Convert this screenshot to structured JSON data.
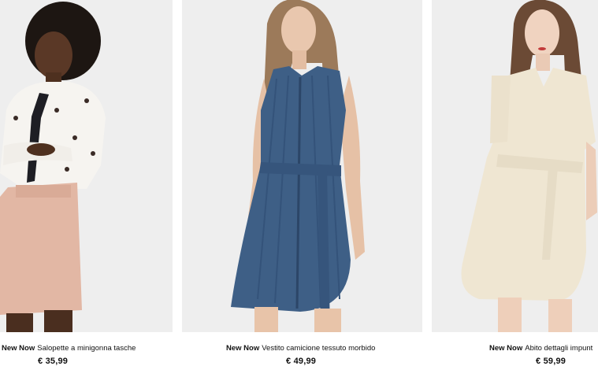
{
  "products": [
    {
      "tag": "New Now",
      "name": "Salopette a minigonna tasche",
      "price": "€ 35,99"
    },
    {
      "tag": "New Now",
      "name": "Vestito camicione tessuto morbido",
      "price": "€ 49,99"
    },
    {
      "tag": "New Now",
      "name": "Abito dettagli impunt",
      "price": "€ 59,99"
    }
  ],
  "colors": {
    "photo_background": "#eeeeee",
    "skirt": "#e2b7a4",
    "denim_dress": "#3e5f86",
    "cream_dress": "#efe6d2"
  }
}
